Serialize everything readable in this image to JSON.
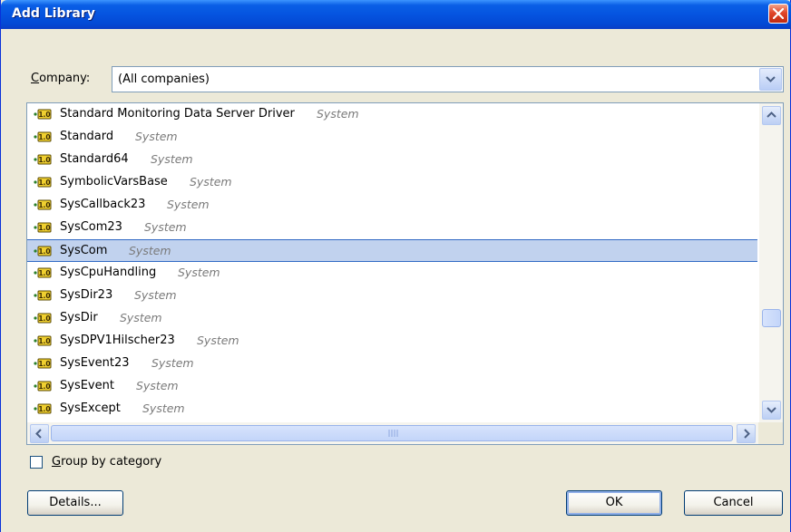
{
  "window": {
    "title": "Add Library"
  },
  "company": {
    "label": "Company:",
    "value": "(All companies)"
  },
  "library_list": {
    "items": [
      {
        "name": "Standard Monitoring Data Server Driver",
        "category": "System"
      },
      {
        "name": "Standard",
        "category": "System"
      },
      {
        "name": "Standard64",
        "category": "System"
      },
      {
        "name": "SymbolicVarsBase",
        "category": "System"
      },
      {
        "name": "SysCallback23",
        "category": "System"
      },
      {
        "name": "SysCom23",
        "category": "System"
      },
      {
        "name": "SysCom",
        "category": "System",
        "selected": true
      },
      {
        "name": "SysCpuHandling",
        "category": "System"
      },
      {
        "name": "SysDir23",
        "category": "System"
      },
      {
        "name": "SysDir",
        "category": "System"
      },
      {
        "name": "SysDPV1Hilscher23",
        "category": "System"
      },
      {
        "name": "SysEvent23",
        "category": "System"
      },
      {
        "name": "SysEvent",
        "category": "System"
      },
      {
        "name": "SysExcept",
        "category": "System"
      }
    ]
  },
  "group_by_category": {
    "label": "Group by category",
    "checked": false
  },
  "buttons": {
    "details": "Details...",
    "ok": "OK",
    "cancel": "Cancel"
  },
  "icons": {
    "library": "library-version-icon",
    "close": "close-icon"
  }
}
